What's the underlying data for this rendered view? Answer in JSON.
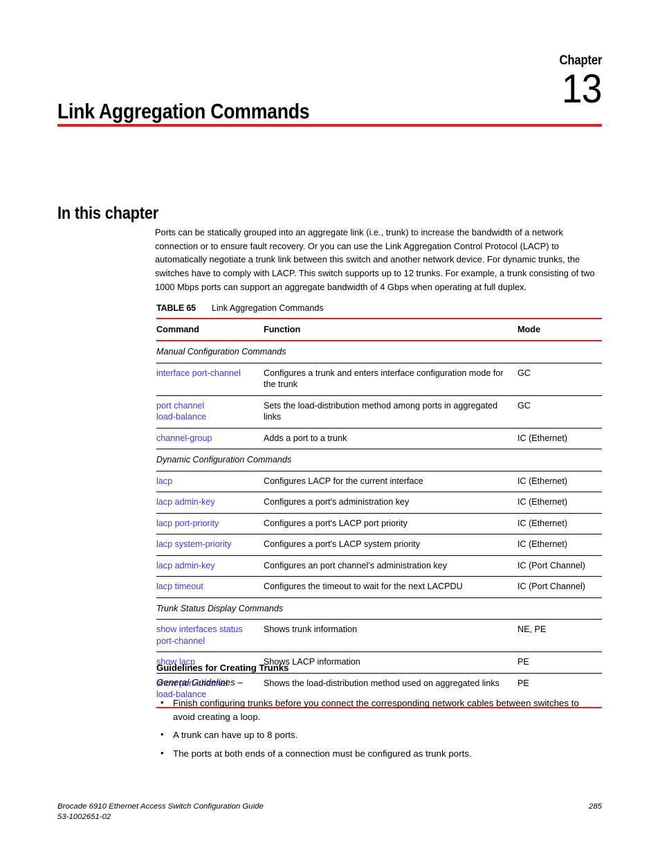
{
  "chapter": {
    "label": "Chapter",
    "number": "13",
    "title": "Link Aggregation Commands",
    "rule_color": "#ed1c24"
  },
  "section": {
    "heading": "In this chapter",
    "paragraph": "Ports can be statically grouped into an aggregate link (i.e., trunk) to increase the bandwidth of a network connection or to ensure fault recovery. Or you can use the Link Aggregation Control Protocol (LACP) to automatically negotiate a trunk link between this switch and another network device. For dynamic trunks, the switches have to comply with LACP. This switch supports up to 12 trunks. For example, a trunk consisting of two 1000 Mbps ports can support an aggregate bandwidth of 4 Gbps when operating at full duplex."
  },
  "table": {
    "caption_label": "TABLE 65",
    "caption_title": "Link Aggregation Commands",
    "link_color": "#3b3bd6",
    "columns": [
      "Command",
      "Function",
      "Mode"
    ],
    "sections": [
      {
        "group": "Manual Configuration Commands",
        "rows": [
          {
            "command_line1": "interface port-channel",
            "command_line2": "",
            "function": "Configures a trunk and enters interface configuration mode for the trunk",
            "mode": "GC"
          },
          {
            "command_line1": "port channel",
            "command_line2": "load-balance",
            "function": "Sets the load-distribution method among ports in aggregated links",
            "mode": "GC"
          },
          {
            "command_line1": "channel-group",
            "command_line2": "",
            "function": "Adds a port to a trunk",
            "mode": "IC (Ethernet)"
          }
        ]
      },
      {
        "group": "Dynamic Configuration Commands",
        "rows": [
          {
            "command_line1": "lacp",
            "command_line2": "",
            "function": "Configures LACP for the current interface",
            "mode": "IC (Ethernet)"
          },
          {
            "command_line1": "lacp admin-key",
            "command_line2": "",
            "function": "Configures a port's administration key",
            "mode": "IC (Ethernet)"
          },
          {
            "command_line1": "lacp port-priority",
            "command_line2": "",
            "function": "Configures a port's LACP port priority",
            "mode": "IC (Ethernet)"
          },
          {
            "command_line1": "lacp system-priority",
            "command_line2": "",
            "function": "Configures a port's LACP system priority",
            "mode": "IC (Ethernet)"
          },
          {
            "command_line1": "lacp admin-key",
            "command_line2": "",
            "function": "Configures an port channel’s administration key",
            "mode": "IC (Port Channel)"
          },
          {
            "command_line1": "lacp timeout",
            "command_line2": "",
            "function": "Configures the timeout to wait for the next LACPDU",
            "mode": "IC (Port Channel)"
          }
        ]
      },
      {
        "group": "Trunk Status Display Commands",
        "rows": [
          {
            "command_line1": "show interfaces status",
            "command_line2": "port-channel",
            "function": "Shows trunk information",
            "mode": "NE, PE"
          },
          {
            "command_line1": "show lacp",
            "command_line2": "",
            "function": "Shows LACP information",
            "mode": "PE"
          },
          {
            "command_line1": "show port-channel",
            "command_line2": "load-balance",
            "function": "Shows the load-distribution method used on aggregated links",
            "mode": "PE"
          }
        ]
      }
    ]
  },
  "guidelines": {
    "heading": "Guidelines for Creating Trunks",
    "subheading": "General Guidelines –",
    "bullet_marker": "•",
    "items": [
      "Finish configuring trunks before you connect the corresponding network cables between switches to avoid creating a loop.",
      "A trunk can have up to 8 ports.",
      "The ports at both ends of a connection must be configured as trunk ports."
    ]
  },
  "footer": {
    "guide_title": "Brocade 6910 Ethernet Access Switch Configuration Guide",
    "doc_number": "53-1002651-02",
    "page_number": "285"
  }
}
